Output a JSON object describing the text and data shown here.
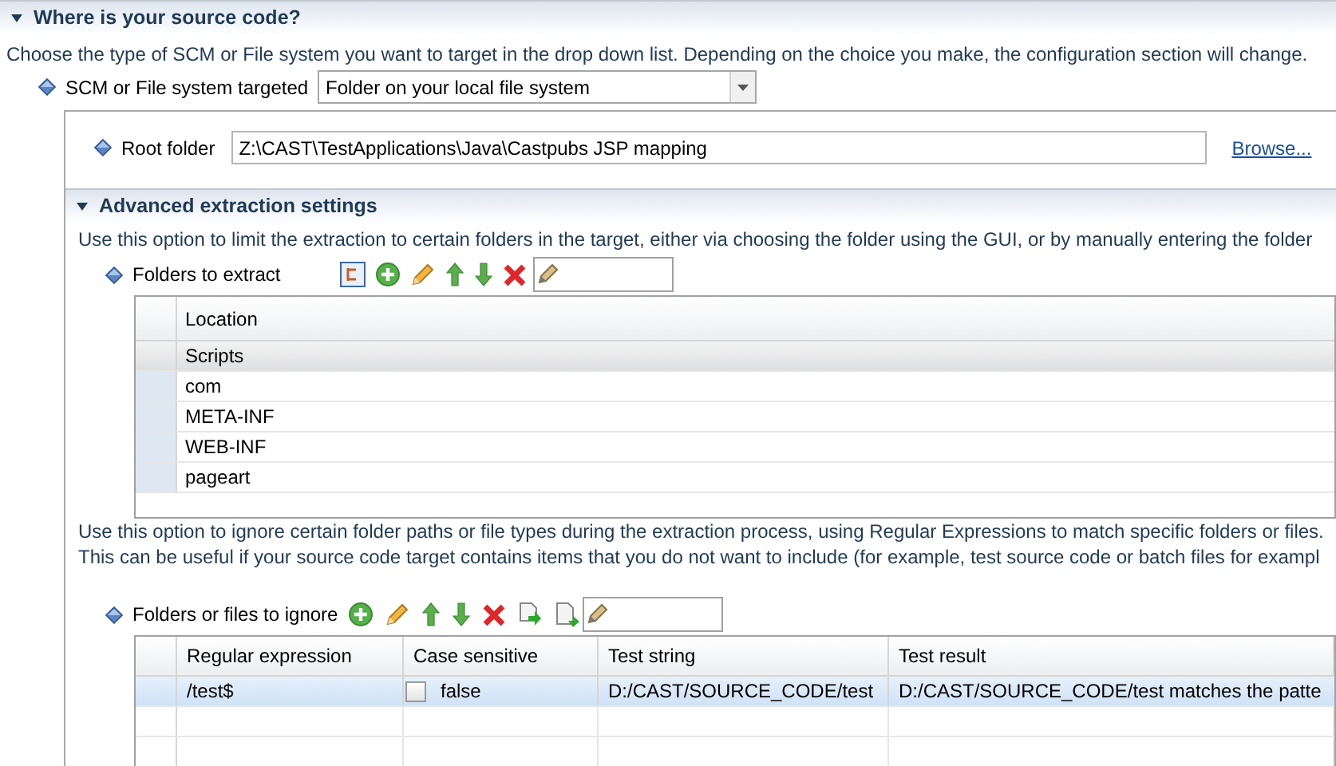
{
  "section": {
    "title": "Where is your source code?",
    "expanded": true
  },
  "description": "Choose the type of SCM or File system you want to target in the drop down list. Depending on the choice you make, the configuration section will change.",
  "scm_field": {
    "label": "SCM or File system targeted",
    "value": "Folder on your local file system"
  },
  "root_folder": {
    "label": "Root folder",
    "value": "Z:\\CAST\\TestApplications\\Java\\Castpubs JSP mapping",
    "browse_link": "Browse..."
  },
  "advanced": {
    "title": "Advanced extraction settings",
    "expanded": true,
    "description": "Use this option to limit the extraction to certain folders in the target, either via choosing the folder using the GUI, or by manually entering the folder",
    "folders_to_extract": {
      "label": "Folders to extract",
      "columns": [
        "Location"
      ],
      "rows": [
        {
          "location": "Scripts",
          "selected": true
        },
        {
          "location": "com",
          "selected": false
        },
        {
          "location": "META-INF",
          "selected": false
        },
        {
          "location": "WEB-INF",
          "selected": false
        },
        {
          "location": "pageart",
          "selected": false
        }
      ]
    },
    "ignore_description": [
      "Use this option to ignore certain folder paths or file types during the extraction process, using Regular Expressions to match specific folders or files.",
      "This can be useful if your source code target contains items that you do not want to include (for example, test source code or batch files for exampl"
    ],
    "folders_to_ignore": {
      "label": "Folders or files to ignore",
      "columns": [
        "Regular expression",
        "Case sensitive",
        "Test string",
        "Test result"
      ],
      "rows": [
        {
          "regex": "/test$",
          "case_sensitive": {
            "checked": false,
            "text": "false"
          },
          "test_string": "D:/CAST/SOURCE_CODE/test",
          "test_result": "D:/CAST/SOURCE_CODE/test matches the patte",
          "selected": true
        }
      ]
    }
  }
}
